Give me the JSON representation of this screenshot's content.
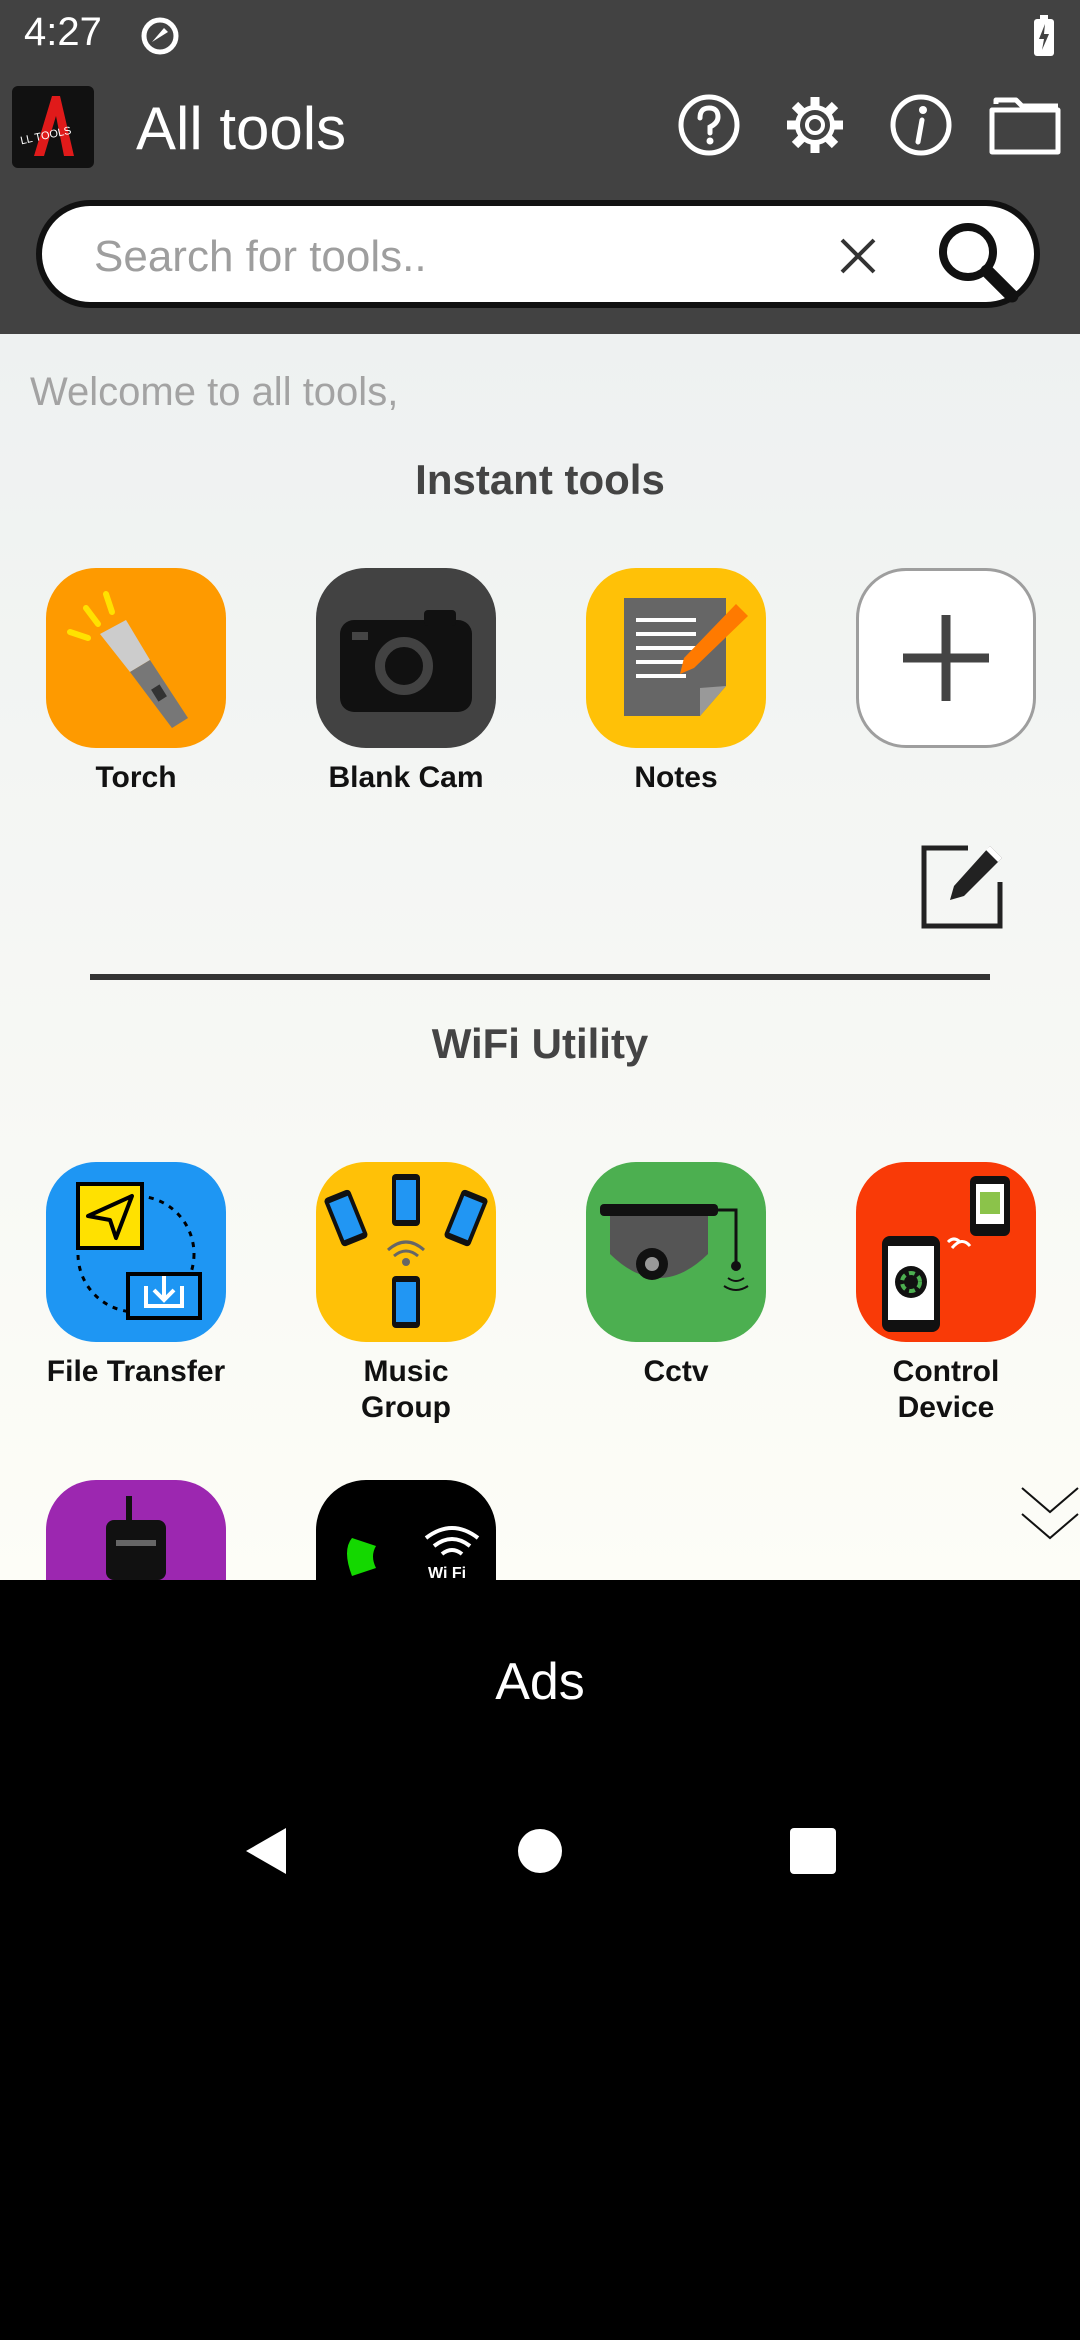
{
  "status": {
    "time": "4:27",
    "icons": [
      "sync-icon",
      "battery-charging-icon"
    ]
  },
  "appbar": {
    "logo_text": "LL TOOLS",
    "title": "All tools",
    "icons": [
      "help-icon",
      "settings-gear-icon",
      "info-icon",
      "folder-icon"
    ]
  },
  "search": {
    "placeholder": "Search for tools..",
    "value": ""
  },
  "content": {
    "welcome": "Welcome to all tools,",
    "instant_title": "Instant tools",
    "instant_tools": [
      {
        "label": "Torch",
        "icon": "torch-icon",
        "color": "#fe9a00"
      },
      {
        "label": "Blank Cam",
        "icon": "camera-icon",
        "color": "#424242"
      },
      {
        "label": "Notes",
        "icon": "notes-icon",
        "color": "#ffc107"
      }
    ],
    "wifi_title": "WiFi Utility",
    "wifi_tools": [
      {
        "label": "File Transfer",
        "icon": "file-transfer-icon",
        "color": "#1e96f3"
      },
      {
        "label": "Music Group",
        "icon": "music-group-icon",
        "color": "#ffc107"
      },
      {
        "label": "Cctv",
        "icon": "cctv-icon",
        "color": "#4caf50"
      },
      {
        "label": "Control Device",
        "icon": "control-device-icon",
        "color": "#f93a07"
      }
    ],
    "more_tools_icons": [
      "walkie-talkie-icon",
      "wifi-call-icon"
    ],
    "more_tools_colors": [
      "#9c27b0",
      "#000000"
    ],
    "wifi_badge": "Wi Fi"
  },
  "ads": {
    "label": "Ads"
  },
  "nav": {
    "icons": [
      "back-icon",
      "home-icon",
      "recents-icon"
    ]
  }
}
